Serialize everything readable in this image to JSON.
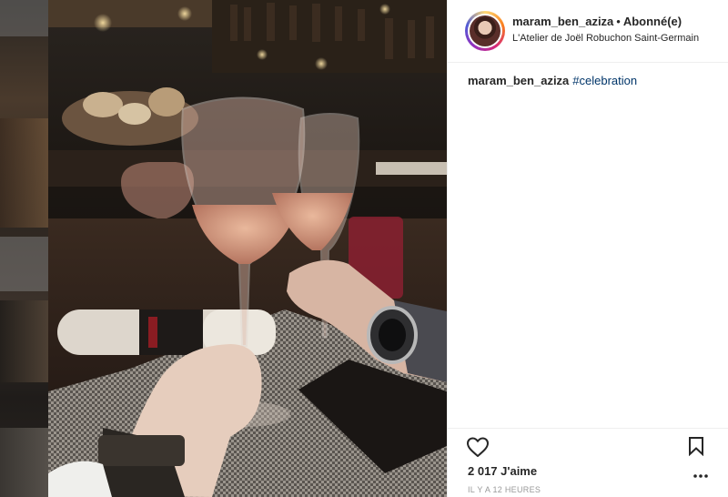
{
  "post": {
    "username": "maram_ben_aziza",
    "separator": "•",
    "follow_status": "Abonné(e)",
    "location": "L'Atelier de Joël Robuchon Saint-Germain"
  },
  "caption": {
    "username": "maram_ben_aziza",
    "hashtag": "#celebration"
  },
  "actions": {
    "like_icon": "heart-outline-icon",
    "save_icon": "bookmark-outline-icon",
    "more_icon": "ellipsis-icon"
  },
  "stats": {
    "likes_text": "2 017 J'aime",
    "timestamp": "IL Y A 12 HEURES"
  },
  "colors": {
    "text": "#262626",
    "hashtag": "#003569",
    "muted": "#999999",
    "divider": "#efefef"
  }
}
